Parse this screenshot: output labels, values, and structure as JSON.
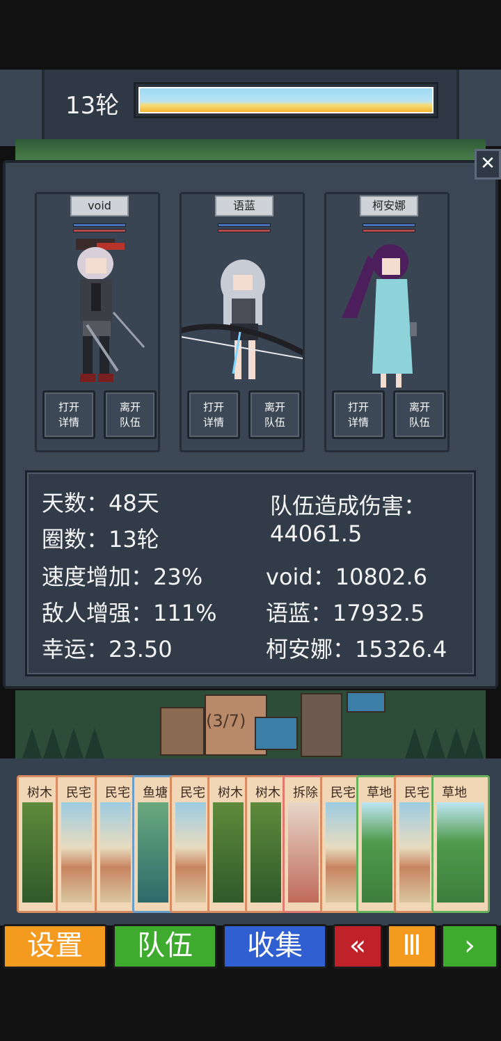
{
  "header": {
    "round": "13轮",
    "progress": 1.0
  },
  "characters": [
    {
      "name": "void",
      "open_btn": "打开\n详情",
      "leave_btn": "离开\n队伍"
    },
    {
      "name": "语蓝",
      "open_btn": "打开\n详情",
      "leave_btn": "离开\n队伍"
    },
    {
      "name": "柯安娜",
      "open_btn": "打开\n详情",
      "leave_btn": "离开\n队伍"
    }
  ],
  "labels": {
    "open_line1": "打开",
    "open_line2": "详情",
    "leave_line1": "离开",
    "leave_line2": "队伍"
  },
  "stats": {
    "days": "天数：48天",
    "laps": "圈数：13轮",
    "speed": "速度增加：23%",
    "enemy": "敌人增强：111%",
    "luck": "幸运：23.50",
    "team_damage_label": "队伍造成伤害：",
    "team_damage_value": "44061.5",
    "void_damage": "void：10802.6",
    "yulan_damage": "语蓝：17932.5",
    "keanna_damage": "柯安娜：15326.4"
  },
  "map": {
    "counter": "(3/7)"
  },
  "cards": [
    {
      "title": "树木",
      "kind": "forest"
    },
    {
      "title": "民宅",
      "kind": "house"
    },
    {
      "title": "民宅",
      "kind": "house"
    },
    {
      "title": "鱼塘",
      "kind": "pond"
    },
    {
      "title": "民宅",
      "kind": "house"
    },
    {
      "title": "树木",
      "kind": "forest"
    },
    {
      "title": "树木",
      "kind": "forest"
    },
    {
      "title": "拆除",
      "kind": "demolish"
    },
    {
      "title": "民宅",
      "kind": "house"
    },
    {
      "title": "草地",
      "kind": "grass"
    },
    {
      "title": "民宅",
      "kind": "house"
    },
    {
      "title": "草地",
      "kind": "grass"
    }
  ],
  "bottom": {
    "settings": "设置",
    "team": "队伍",
    "collect": "收集",
    "rewind": "«",
    "pause": "Ⅲ",
    "play": "›"
  },
  "colors": {
    "settings": "#f39a1f",
    "team": "#3eab2e",
    "collect": "#2f5fd0",
    "rewind": "#c0222b",
    "pause": "#f39a1f",
    "play": "#3eab2e"
  }
}
